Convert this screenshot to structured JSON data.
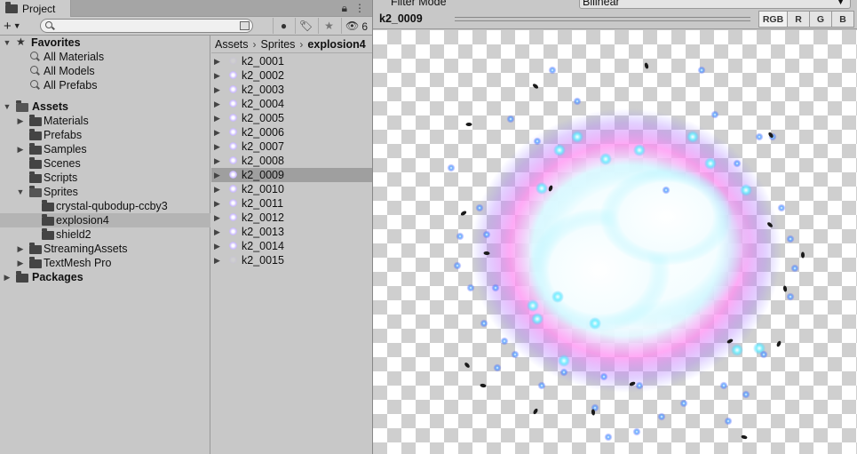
{
  "project_tab": {
    "title": "Project"
  },
  "toolbar": {
    "search_placeholder": "",
    "hidden_count": "6"
  },
  "tree": {
    "favorites": {
      "label": "Favorites",
      "items": [
        "All Materials",
        "All Models",
        "All Prefabs"
      ]
    },
    "assets": {
      "label": "Assets",
      "children": [
        {
          "label": "Materials"
        },
        {
          "label": "Prefabs"
        },
        {
          "label": "Samples"
        },
        {
          "label": "Scenes"
        },
        {
          "label": "Scripts"
        },
        {
          "label": "Sprites"
        },
        {
          "label": "crystal-qubodup-ccby3"
        },
        {
          "label": "explosion4"
        },
        {
          "label": "shield2"
        },
        {
          "label": "StreamingAssets"
        },
        {
          "label": "TextMesh Pro"
        }
      ]
    },
    "packages": {
      "label": "Packages"
    }
  },
  "breadcrumb": [
    "Assets",
    "Sprites",
    "explosion4"
  ],
  "files": [
    "k2_0001",
    "k2_0002",
    "k2_0003",
    "k2_0004",
    "k2_0005",
    "k2_0006",
    "k2_0007",
    "k2_0008",
    "k2_0009",
    "k2_0010",
    "k2_0011",
    "k2_0012",
    "k2_0013",
    "k2_0014",
    "k2_0015"
  ],
  "selected_file": "k2_0009",
  "inspector": {
    "filter_label": "Filter Mode",
    "filter_value": "Bilinear",
    "preview_title": "k2_0009",
    "channels": [
      "RGB",
      "R",
      "G",
      "B"
    ]
  }
}
